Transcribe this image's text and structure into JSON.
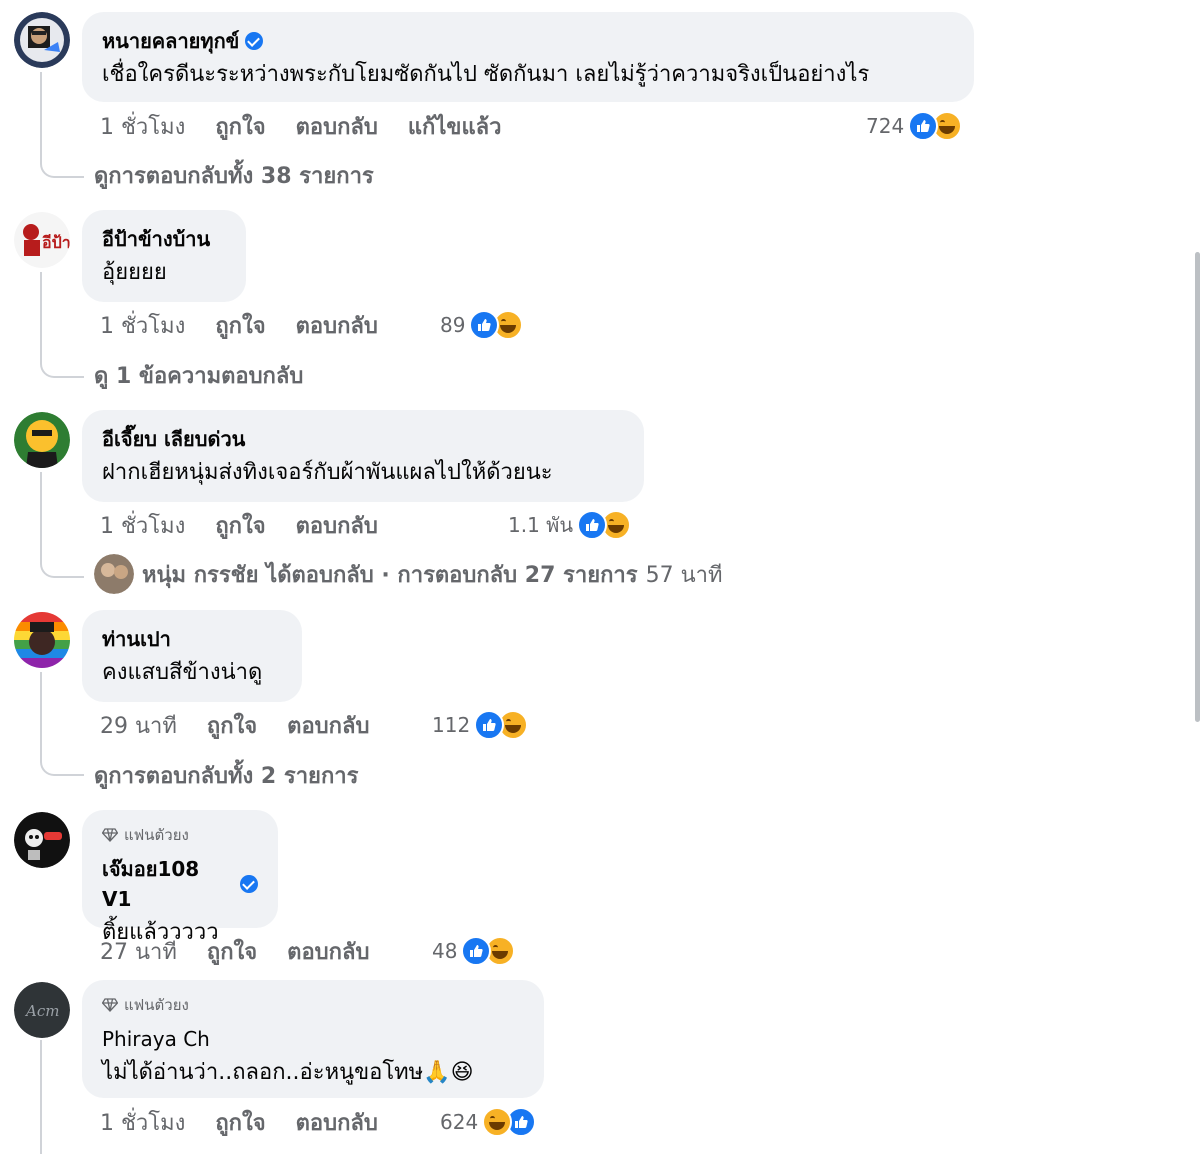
{
  "comments": [
    {
      "name": "หนายคลายทุกข์",
      "verified": true,
      "text": "เชื่อใครดีนะระหว่างพระกับโยมซัดกันไป ซัดกันมา เลยไม่รู้ว่าความจริงเป็นอย่างไร",
      "time": "1 ชั่วโมง",
      "like": "ถูกใจ",
      "reply": "ตอบกลับ",
      "edited": "แก้ไขแล้ว",
      "reaction_count": "724",
      "replies_link": "ดูการตอบกลับทั้ง 38 รายการ"
    },
    {
      "name": "อีป้าข้างบ้าน",
      "text": "อุ้ยยยย",
      "time": "1 ชั่วโมง",
      "like": "ถูกใจ",
      "reply": "ตอบกลับ",
      "reaction_count": "89",
      "replies_link": "ดู 1 ข้อความตอบกลับ"
    },
    {
      "name": "อีเจี๊ยบ เลียบด่วน",
      "text": "ฝากเฮียหนุ่มส่งทิงเจอร์กับผ้าพันแผลไปให้ด้วยนะ",
      "time": "1 ชั่วโมง",
      "like": "ถูกใจ",
      "reply": "ตอบกลับ",
      "reaction_count": "1.1 พัน",
      "replies_link": "หนุ่ม กรรชัย ได้ตอบกลับ · การตอบกลับ 27 รายการ",
      "replies_time": "57 นาที"
    },
    {
      "name": "ท่านเปา",
      "text": "คงแสบสีข้างน่าดู",
      "time": "29 นาที",
      "like": "ถูกใจ",
      "reply": "ตอบกลับ",
      "reaction_count": "112",
      "replies_link": "ดูการตอบกลับทั้ง 2 รายการ"
    },
    {
      "badge": "แฟนตัวยง",
      "name": "เจ๊มอย108 V1",
      "verified": true,
      "text": "ติ้ยแล้ววววว",
      "time": "27 นาที",
      "like": "ถูกใจ",
      "reply": "ตอบกลับ",
      "reaction_count": "48"
    },
    {
      "badge": "แฟนตัวยง",
      "name": "Phiraya Ch",
      "text": "ไม่ได้อ่านว่า..ถลอก..อ่ะหนูขอโทษ🙏😆",
      "time": "1 ชั่วโมง",
      "like": "ถูกใจ",
      "reply": "ตอบกลับ",
      "reaction_count": "624"
    }
  ],
  "colors": {
    "bubble": "#f0f2f5",
    "meta_text": "#65676b",
    "like_blue": "#1877f2",
    "haha_yellow": "#f7b125"
  },
  "icons": [
    "verified-icon",
    "like-reaction-icon",
    "haha-reaction-icon",
    "diamond-icon"
  ]
}
